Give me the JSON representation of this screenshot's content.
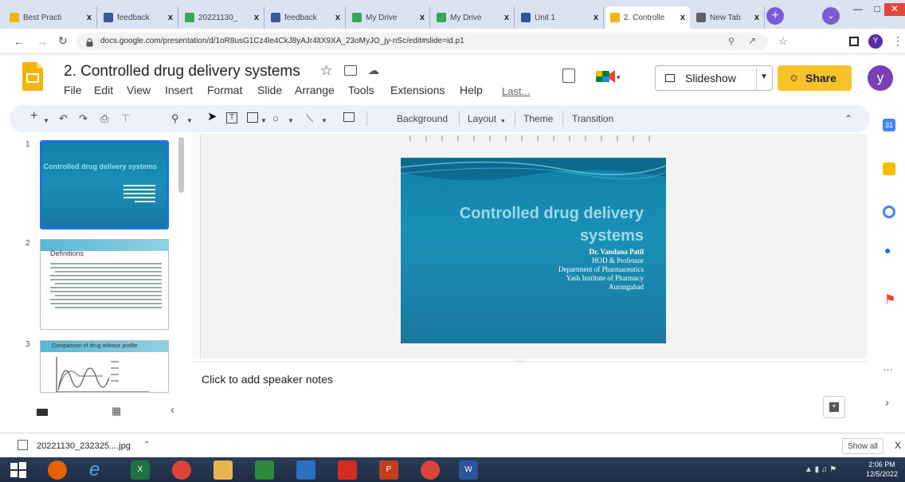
{
  "browser": {
    "tabs": [
      {
        "title": "Best Practi",
        "favicon_color": "#f4b400",
        "active": false
      },
      {
        "title": "feedback",
        "favicon_color": "#3b5998",
        "active": false
      },
      {
        "title": "20221130_",
        "favicon_color": "#34a853",
        "active": false
      },
      {
        "title": "feedback",
        "favicon_color": "#3b5998",
        "active": false
      },
      {
        "title": "My Drive",
        "favicon_color": "#34a853",
        "active": false
      },
      {
        "title": "My Drive",
        "favicon_color": "#34a853",
        "active": false
      },
      {
        "title": "Unit 1",
        "favicon_color": "#2b579a",
        "active": false
      },
      {
        "title": "2. Controlle",
        "favicon_color": "#f4b400",
        "active": true
      },
      {
        "title": "New Tab",
        "favicon_color": "#5f6368",
        "active": false
      }
    ],
    "close_glyph": "x",
    "new_tab_glyph": "+",
    "url": "docs.google.com/presentation/d/1oR8usG1Cz4le4CkJ8yAJr4ltX9XA_23oMyJO_jy-nSc/edit#slide=id.p1",
    "profile_initial": "Y"
  },
  "doc": {
    "title": "2. Controlled drug delivery systems",
    "menus": [
      "File",
      "Edit",
      "View",
      "Insert",
      "Format",
      "Slide",
      "Arrange",
      "Tools",
      "Extensions",
      "Help"
    ],
    "last_edit": "Last...",
    "slideshow_label": "Slideshow",
    "share_label": "Share",
    "user_initial": "y"
  },
  "toolbar": {
    "background": "Background",
    "layout": "Layout",
    "theme": "Theme",
    "transition": "Transition"
  },
  "filmstrip": {
    "slides": [
      {
        "num": "1",
        "title": "Controlled drug delivery systems"
      },
      {
        "num": "2",
        "title": "Definitions"
      },
      {
        "num": "3",
        "title": "Comparison of drug release profile"
      }
    ]
  },
  "slide": {
    "title_line1": "Controlled drug delivery",
    "title_line2": "systems",
    "lines": [
      "Dr. Vandana Patil",
      "HOD & Professor",
      "Department of Pharmaceutics",
      "Yash Institute of Pharmacy",
      "Aurangabad"
    ]
  },
  "notes": {
    "placeholder": "Click to add speaker notes"
  },
  "downloads": {
    "file": "20221130_232325....jpg",
    "show_all": "Show all",
    "close": "X"
  },
  "taskbar": {
    "time": "2:06 PM",
    "date": "12/5/2022"
  },
  "colors": {
    "accent": "#1a73e8",
    "share": "#f8c22b",
    "slide_bg": "#1a86ad"
  }
}
